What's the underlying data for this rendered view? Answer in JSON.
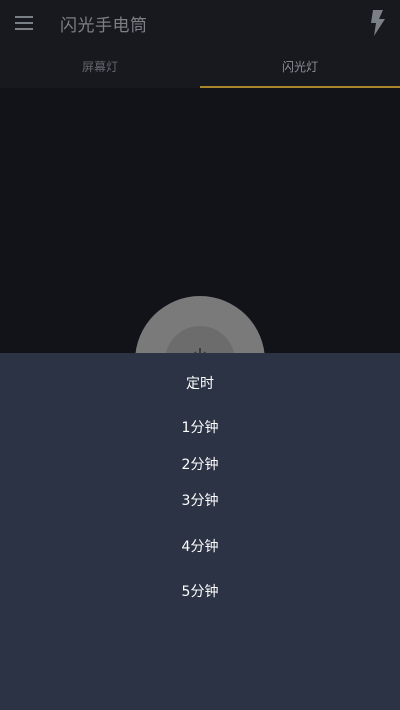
{
  "app": {
    "title": "闪光手电筒",
    "menu_icon": "hamburger-menu-icon",
    "flash_icon": "lightning-bolt-icon"
  },
  "tabs": [
    {
      "label": "屏幕灯",
      "active": false
    },
    {
      "label": "闪光灯",
      "active": true
    }
  ],
  "power_button": {
    "icon": "power-icon"
  },
  "timer_sheet": {
    "title": "定时",
    "options": [
      "1分钟",
      "2分钟",
      "3分钟",
      "4分钟",
      "5分钟"
    ]
  },
  "colors": {
    "accent": "#a9852c",
    "sheet_bg": "#2b3344",
    "background": "#111318"
  }
}
